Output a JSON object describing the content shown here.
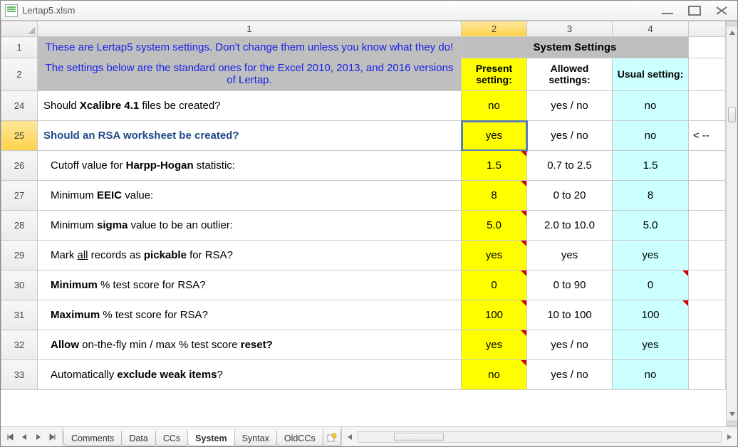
{
  "window": {
    "title": "Lertap5.xlsm"
  },
  "columns": [
    "1",
    "2",
    "3",
    "4"
  ],
  "banner": {
    "line1": "These are Lertap5 system settings. Don't change them unless you know what they do!",
    "line2": "The settings below are the standard ones for the Excel 2010, 2013, and 2016 versions of Lertap."
  },
  "headers": {
    "title": "System Settings",
    "present": "Present setting:",
    "allowed": "Allowed settings:",
    "usual": "Usual setting:"
  },
  "row_numbers": {
    "hdr1": "1",
    "hdr2": "2"
  },
  "rows": [
    {
      "n": "24",
      "desc_html": "Should <b>Xcalibre 4.1</b> files be created?",
      "present": "no",
      "allowed": "yes / no",
      "usual": "no",
      "indent": 0,
      "active": false,
      "present_mark": false,
      "usual_mark": false,
      "note": ""
    },
    {
      "n": "25",
      "desc_html": "Should an RSA worksheet be created?",
      "present": "yes",
      "allowed": "yes / no",
      "usual": "no",
      "indent": 0,
      "active": true,
      "present_mark": false,
      "usual_mark": false,
      "note": "< --"
    },
    {
      "n": "26",
      "desc_html": "Cutoff value for <b>Harpp-Hogan</b> statistic:",
      "present": "1.5",
      "allowed": "0.7 to 2.5",
      "usual": "1.5",
      "indent": 1,
      "active": false,
      "present_mark": true,
      "usual_mark": false,
      "note": ""
    },
    {
      "n": "27",
      "desc_html": "Minimum <b>EEIC</b> value:",
      "present": "8",
      "allowed": "0 to 20",
      "usual": "8",
      "indent": 1,
      "active": false,
      "present_mark": true,
      "usual_mark": false,
      "note": ""
    },
    {
      "n": "28",
      "desc_html": "Minimum <b>sigma</b> value to be an outlier:",
      "present": "5.0",
      "allowed": "2.0 to 10.0",
      "usual": "5.0",
      "indent": 1,
      "active": false,
      "present_mark": true,
      "usual_mark": false,
      "note": ""
    },
    {
      "n": "29",
      "desc_html": "Mark <span class='underline'>all</span> records as <b>pickable</b> for RSA?",
      "present": "yes",
      "allowed": "yes",
      "usual": "yes",
      "indent": 1,
      "active": false,
      "present_mark": true,
      "usual_mark": false,
      "note": ""
    },
    {
      "n": "30",
      "desc_html": "<b>Minimum</b> % test score for RSA?",
      "present": "0",
      "allowed": "0 to 90",
      "usual": "0",
      "indent": 1,
      "active": false,
      "present_mark": true,
      "usual_mark": true,
      "note": ""
    },
    {
      "n": "31",
      "desc_html": "<b>Maximum</b> % test score for RSA?",
      "present": "100",
      "allowed": "10 to 100",
      "usual": "100",
      "indent": 1,
      "active": false,
      "present_mark": true,
      "usual_mark": true,
      "note": ""
    },
    {
      "n": "32",
      "desc_html": "<b>Allow</b> on-the-fly min / max % test score <b>reset?</b>",
      "present": "yes",
      "allowed": "yes / no",
      "usual": "yes",
      "indent": 1,
      "active": false,
      "present_mark": true,
      "usual_mark": false,
      "note": ""
    },
    {
      "n": "33",
      "desc_html": "Automatically <b>exclude weak items</b>?",
      "present": "no",
      "allowed": "yes / no",
      "usual": "no",
      "indent": 1,
      "active": false,
      "present_mark": true,
      "usual_mark": false,
      "note": ""
    }
  ],
  "tabs": [
    "Comments",
    "Data",
    "CCs",
    "System",
    "Syntax",
    "OldCCs"
  ],
  "active_tab": "System",
  "selected_cell_row": "25"
}
